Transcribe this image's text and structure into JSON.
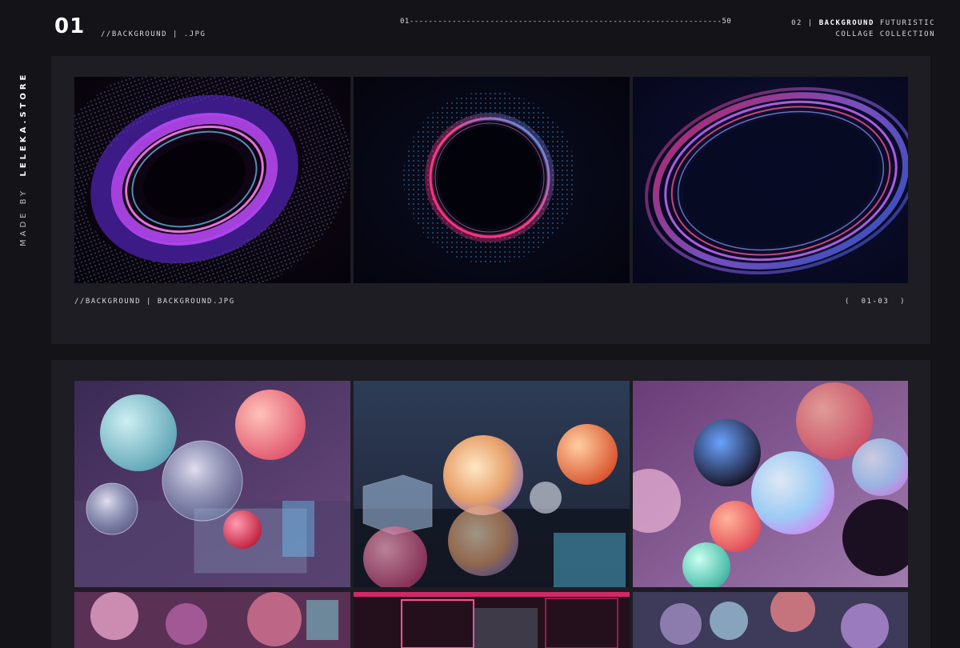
{
  "header": {
    "page_number": "01",
    "file_type": "//BACKGROUND | .JPG",
    "progress_start": "01",
    "progress_end": "50",
    "collection_index": "02 |",
    "collection_bold": "BACKGROUND",
    "collection_line1_rest": "FUTURISTIC",
    "collection_line2": "COLLAGE COLLECTION"
  },
  "side_credit": {
    "prefix": "MADE BY",
    "brand": "LELEKA.STORE"
  },
  "section1": {
    "caption": "//BACKGROUND | BACKGROUND.JPG",
    "range_open": "(",
    "range": "01-03",
    "range_close": ")",
    "images": [
      {
        "subject": "purple-particle-wormhole"
      },
      {
        "subject": "neon-red-blue-ring"
      },
      {
        "subject": "purple-light-swirl"
      }
    ]
  },
  "section2": {
    "images": [
      {
        "subject": "glass-spheres-and-cubes"
      },
      {
        "subject": "iridescent-bubble-and-cube"
      },
      {
        "subject": "holographic-spheres"
      },
      {
        "subject": "pink-spheres-partial"
      },
      {
        "subject": "neon-glass-cubes-partial"
      },
      {
        "subject": "glass-orbs-partial"
      }
    ]
  },
  "colors": {
    "background": "#131318",
    "panel": "#1d1d23",
    "text": "#d9d9de",
    "accent_purple": "#b44bff",
    "accent_pink": "#ff2d7a",
    "accent_blue": "#2fa8ff"
  }
}
